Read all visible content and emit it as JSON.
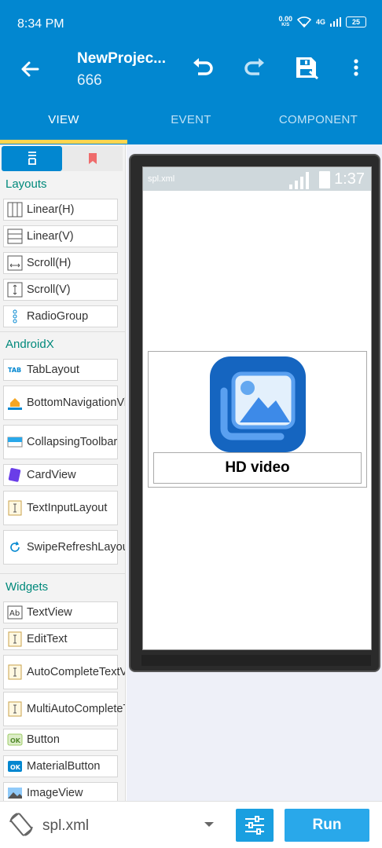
{
  "status": {
    "time": "8:34 PM",
    "net_speed_top": "0.00",
    "net_speed_bottom": "K/S",
    "signal_label": "4G",
    "battery": "25"
  },
  "toolbar": {
    "title": "NewProjec...",
    "subtitle": "666",
    "icons": [
      "back-arrow-icon",
      "undo-icon",
      "redo-icon",
      "save-icon",
      "more-vert-icon"
    ]
  },
  "tabs": [
    {
      "label": "VIEW",
      "active": true
    },
    {
      "label": "EVENT",
      "active": false
    },
    {
      "label": "COMPONENT",
      "active": false
    }
  ],
  "sidebar": {
    "sections": [
      {
        "title": "Layouts",
        "items": [
          {
            "label": "Linear(H)",
            "icon": "linear-h-icon"
          },
          {
            "label": "Linear(V)",
            "icon": "linear-v-icon"
          },
          {
            "label": "Scroll(H)",
            "icon": "scroll-h-icon"
          },
          {
            "label": "Scroll(V)",
            "icon": "scroll-v-icon"
          },
          {
            "label": "RadioGroup",
            "icon": "radiogroup-icon"
          }
        ]
      },
      {
        "title": "AndroidX",
        "items": [
          {
            "label": "TabLayout",
            "icon": "tablayout-icon"
          },
          {
            "label": "BottomNavigationView",
            "icon": "bottom-nav-icon"
          },
          {
            "label": "CollapsingToolbar",
            "icon": "collapsing-toolbar-icon"
          },
          {
            "label": "CardView",
            "icon": "cardview-icon"
          },
          {
            "label": "TextInputLayout",
            "icon": "textinput-icon"
          },
          {
            "label": "SwipeRefreshLayout",
            "icon": "swipe-refresh-icon"
          }
        ]
      },
      {
        "title": "Widgets",
        "items": [
          {
            "label": "TextView",
            "icon": "textview-icon"
          },
          {
            "label": "EditText",
            "icon": "edittext-icon"
          },
          {
            "label": "AutoCompleteTextView",
            "icon": "autocomplete-icon"
          },
          {
            "label": "MultiAutoCompleteTextView",
            "icon": "multiautocomplete-icon"
          },
          {
            "label": "Button",
            "icon": "button-icon"
          },
          {
            "label": "MaterialButton",
            "icon": "materialbutton-icon"
          },
          {
            "label": "ImageView",
            "icon": "imageview-icon"
          }
        ]
      }
    ]
  },
  "preview": {
    "file": "spl.xml",
    "time": "1:37",
    "label": "HD video"
  },
  "bottom": {
    "file": "spl.xml",
    "run": "Run"
  },
  "colors": {
    "primary": "#0287d0",
    "accent": "#ffd54f",
    "section": "#00897b"
  }
}
